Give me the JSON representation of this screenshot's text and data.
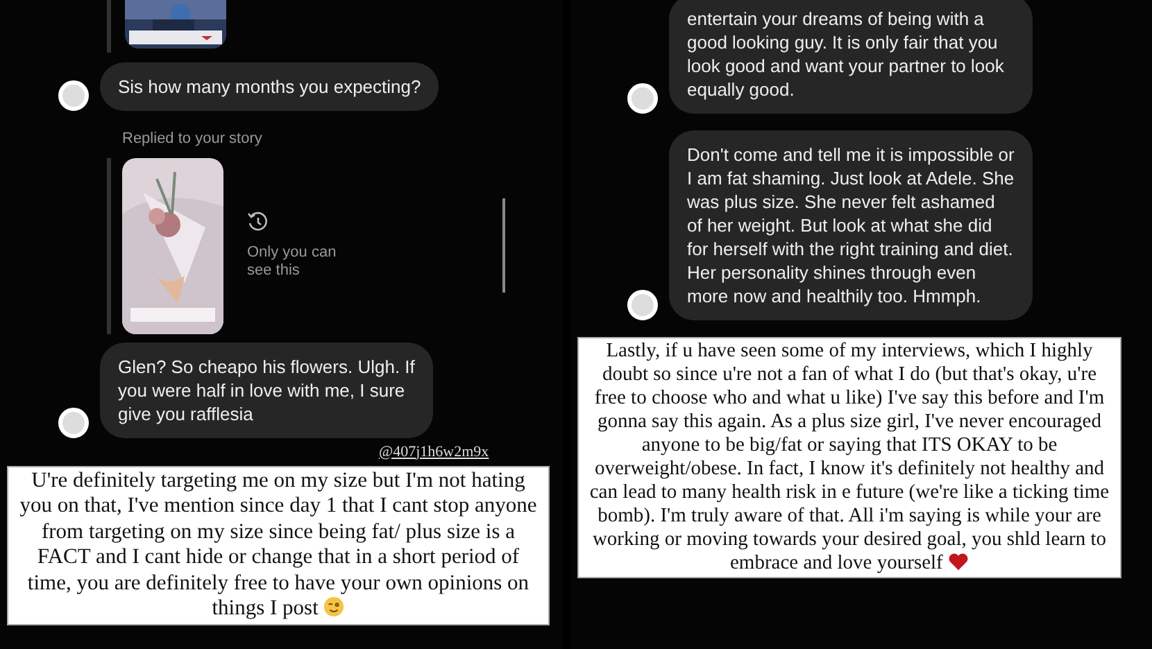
{
  "left_chat": {
    "first_message": "Sis how many months you expecting?",
    "reply_label": "Replied to your story",
    "story_note": "Only you can see this",
    "second_message": "Glen? So cheapo his flowers. Ulgh. If you were half in love with me, I sure give you rafflesia",
    "username": "@407j1h6w2m9x"
  },
  "left_caption": "U're definitely targeting me on my size but I'm not hating you on that, I've mention since day 1 that I cant stop anyone from targeting on my size since being fat/ plus size is a FACT and I cant hide or change that in a short period of time, you are definitely free to have your own opinions on things I post",
  "right_chat": {
    "messages": [
      {
        "text": "entertain your dreams of being with a good looking guy. It is only fair that you look good and want your partner to look equally good."
      },
      {
        "text": "Don't come and tell me it is impossible or I am fat shaming. Just look at Adele. She was plus size. She never felt ashamed of her weight. But look at what she did for herself with the right training and diet. Her personality shines through even more now and healthily too. Hmmph."
      }
    ]
  },
  "right_caption": "Lastly, if u have seen some of my interviews, which I highly doubt so since u're not a fan of what I do (but that's okay, u're free to choose who and what u like) I've say this before and I'm gonna say this again. As a plus size girl, I've never encouraged anyone to be big/fat or saying that ITS OKAY to be overweight/obese. In fact, I know it's definitely not healthy and can lead to many health risk in e future (we're like a ticking time bomb). I'm truly aware of that. All i'm saying is while your are working or moving towards your desired goal, you shld learn to embrace and love yourself"
}
